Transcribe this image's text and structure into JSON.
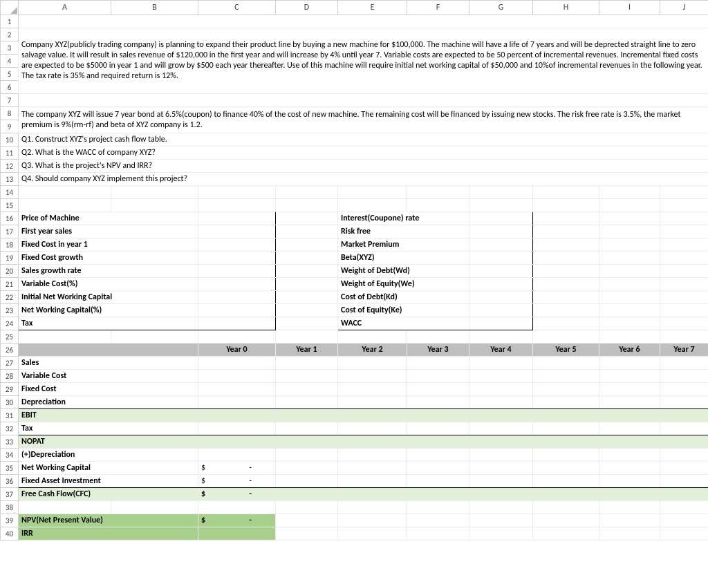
{
  "columns": [
    "A",
    "B",
    "C",
    "D",
    "E",
    "F",
    "G",
    "H",
    "I",
    "J"
  ],
  "rows": [
    "1",
    "2",
    "3",
    "4",
    "5",
    "6",
    "7",
    "8",
    "9",
    "10",
    "11",
    "12",
    "13",
    "14",
    "15",
    "16",
    "17",
    "18",
    "19",
    "20",
    "21",
    "22",
    "23",
    "24",
    "25",
    "26",
    "27",
    "28",
    "29",
    "30",
    "31",
    "32",
    "33",
    "34",
    "35",
    "36",
    "37",
    "38",
    "39",
    "40"
  ],
  "narrative": {
    "p1": "Company XYZ(publicly trading company) is planning to expand their product line by buying a new machine for $100,000.  The machine will have a life of 7 years and will be deprected straight line to zero salvage value. It will result in sales revenue of $120,000 in the first year and will increase  by 4% until year 7.  Variable costs are expected to be 50 percent of incremental revenues. Incremental fixed costs are expected to be $5000 in year 1 and will grow by $500 each year thereafter. Use of this machine will require initial net working capital  of $50,000  and 10%of incremental revenues in the following year. The tax rate is 35% and required return is 12%.",
    "p2": "The company XYZ will issue 7 year  bond at 6.5%(coupon)  to finance 40% of the cost of new machine. The remaining cost will be financed by issuing new stocks. The risk free rate is 3.5%, the market premium is  9%(rm-rf) and beta of XYZ company is 1.2.",
    "q1": "Q1. Construct XYZ's project cash flow table.",
    "q2": "Q2. What is the WACC of company XYZ?",
    "q3": "Q3. What is the project's NPV and IRR?",
    "q4": "Q4. Should company XYZ implement this  project?"
  },
  "labels_left": {
    "r16": "Price of Machine",
    "r17": "First year sales",
    "r18": "Fixed Cost in year 1",
    "r19": "Fixed Cost growth",
    "r20": "Sales growth rate",
    "r21": "Variable Cost(%)",
    "r22": "Initial Net Working Capital",
    "r23": "Net Working Capital(%)",
    "r24": "Tax"
  },
  "labels_right": {
    "r16": "Interest(Coupone) rate",
    "r17": "Risk free",
    "r18": "Market Premium",
    "r19": "Beta(XYZ)",
    "r20": "Weight of Debt(Wd)",
    "r21": "Weight of Equity(We)",
    "r22": "Cost of Debt(Kd)",
    "r23": "Cost of Equity(Ke)",
    "r24": "WACC"
  },
  "years": {
    "y0": "Year 0",
    "y1": "Year 1",
    "y2": "Year 2",
    "y3": "Year 3",
    "y4": "Year 4",
    "y5": "Year 5",
    "y6": "Year 6",
    "y7": "Year 7"
  },
  "rows_cfc": {
    "r27": "Sales",
    "r28": "Variable Cost",
    "r29": "Fixed Cost",
    "r30": "Depreciation",
    "r31": "EBIT",
    "r32": "Tax",
    "r33": "NOPAT",
    "r34": "(+)Depreciation",
    "r35": "Net Working Capital",
    "r36": "Fixed Asset Investment",
    "r37": "Free Cash Flow(CFC)",
    "r39": "NPV(Net Present Value)",
    "r40": "IRR"
  },
  "vals": {
    "dollar": "$",
    "dash": "-"
  }
}
